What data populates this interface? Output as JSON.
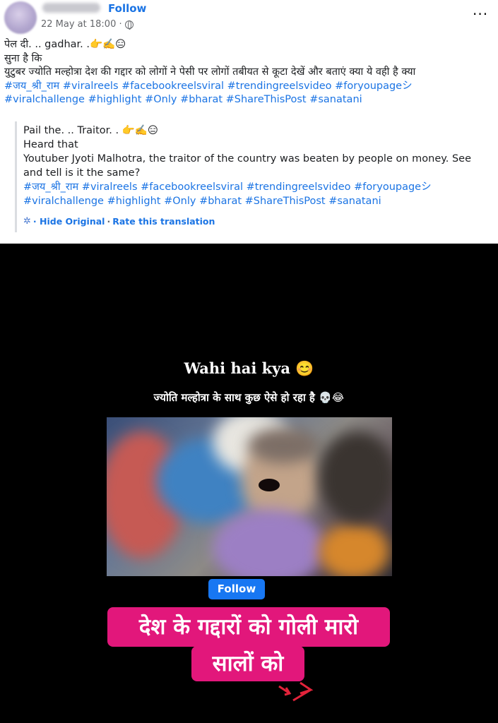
{
  "post": {
    "follow_label": "Follow",
    "timestamp": "22 May at 18:00 ·",
    "more_label": "···",
    "text_lines": [
      "पेल दी. .. gadhar. .👉✍️😑",
      "सुना है कि",
      "युटुबर ज्योति मल्होत्रा देश की गद्दार को लोगों ने पेसी पर लोगों तबीयत से कूटा देखें और बताएं क्या ये वही है क्या"
    ],
    "hashtags_line1": " #जय_श्री_राम #viralreels #facebookreelsviral #trendingreelsvideo #foryoupageシ",
    "hashtags_line2": "#viralchallenge #highlight #Only #bharat #ShareThisPost #sanatani"
  },
  "translation": {
    "lines": [
      "Pail the. .. Traitor. . 👉✍️😑",
      "Heard that",
      "Youtuber Jyoti Malhotra, the traitor of the country was beaten by people on money. See and tell is it the same?"
    ],
    "hashtags_line1": " #जय_श्री_राम #viralreels #facebookreelsviral #trendingreelsvideo #foryoupageシ",
    "hashtags_line2": "#viralchallenge #highlight #Only #bharat #ShareThisPost #sanatani",
    "hide_original": "· Hide Original",
    "separator": "·",
    "rate": "Rate this translation"
  },
  "video": {
    "caption_top": "Wahi hai kya 😊",
    "caption_hindi": "ज्योति मल्होत्रा के साथ कुछ ऐसे हो रहा है 💀😂",
    "follow_button": "Follow",
    "pink_line1": "देश के गद्दारों को गोली मारो",
    "pink_line2": "सालों को"
  },
  "icons": {
    "privacy": "globe-icon",
    "translation_settings": "gear-icon",
    "options": "more-options-icon"
  },
  "colors": {
    "link_blue": "#1b74e4",
    "follow_button_bg": "#1877f2",
    "caption_pink": "#e2177b",
    "video_bg": "#000000"
  }
}
